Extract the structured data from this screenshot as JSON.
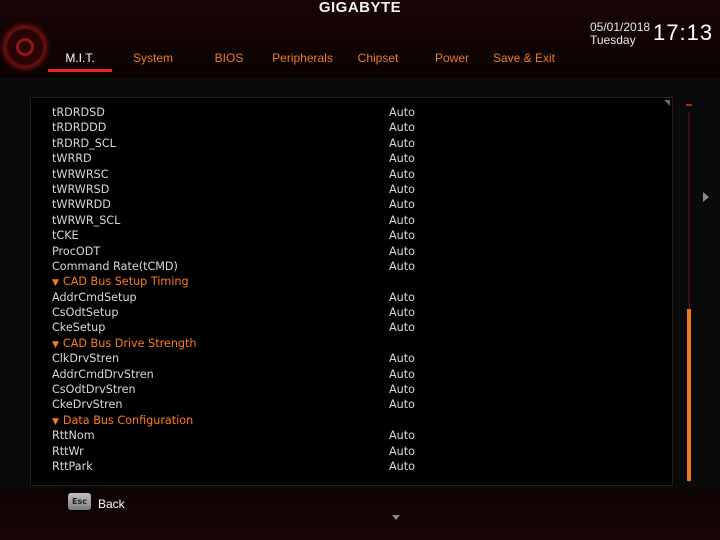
{
  "brand": "GIGABYTE",
  "tabs": [
    {
      "label": "M.I.T.",
      "active": true
    },
    {
      "label": "System",
      "active": false
    },
    {
      "label": "BIOS",
      "active": false
    },
    {
      "label": "Peripherals",
      "active": false
    },
    {
      "label": "Chipset",
      "active": false
    },
    {
      "label": "Power",
      "active": false
    },
    {
      "label": "Save & Exit",
      "active": false
    }
  ],
  "datetime": {
    "date": "05/01/2018",
    "day": "Tuesday",
    "time": "17:13"
  },
  "settings": [
    {
      "label": "tRDRDSD",
      "value": "Auto"
    },
    {
      "label": "tRDRDDD",
      "value": "Auto"
    },
    {
      "label": "tRDRD_SCL",
      "value": "Auto"
    },
    {
      "label": "tWRRD",
      "value": "Auto"
    },
    {
      "label": "tWRWRSC",
      "value": "Auto"
    },
    {
      "label": "tWRWRSD",
      "value": "Auto"
    },
    {
      "label": "tWRWRDD",
      "value": "Auto"
    },
    {
      "label": "tWRWR_SCL",
      "value": "Auto"
    },
    {
      "label": "tCKE",
      "value": "Auto"
    },
    {
      "label": "ProcODT",
      "value": "Auto"
    },
    {
      "label": "Command Rate(tCMD)",
      "value": "Auto"
    },
    {
      "label": "CAD Bus Setup Timing",
      "value": "",
      "section": true
    },
    {
      "label": "AddrCmdSetup",
      "value": "Auto"
    },
    {
      "label": "CsOdtSetup",
      "value": "Auto"
    },
    {
      "label": "CkeSetup",
      "value": "Auto"
    },
    {
      "label": "CAD Bus Drive Strength",
      "value": "",
      "section": true
    },
    {
      "label": "ClkDrvStren",
      "value": "Auto"
    },
    {
      "label": "AddrCmdDrvStren",
      "value": "Auto"
    },
    {
      "label": "CsOdtDrvStren",
      "value": "Auto"
    },
    {
      "label": "CkeDrvStren",
      "value": "Auto"
    },
    {
      "label": "Data Bus Configuration",
      "value": "",
      "section": true
    },
    {
      "label": "RttNom",
      "value": "Auto"
    },
    {
      "label": "RttWr",
      "value": "Auto"
    },
    {
      "label": "RttPark",
      "value": "Auto"
    }
  ],
  "footer": {
    "esc_key": "Esc",
    "back_label": "Back"
  },
  "colors": {
    "accent": "#e8281c",
    "section": "#ff7a1a",
    "tab": "#e87a2a"
  },
  "scroll": {
    "position_fraction": 0.55,
    "visible_fraction": 0.45
  }
}
